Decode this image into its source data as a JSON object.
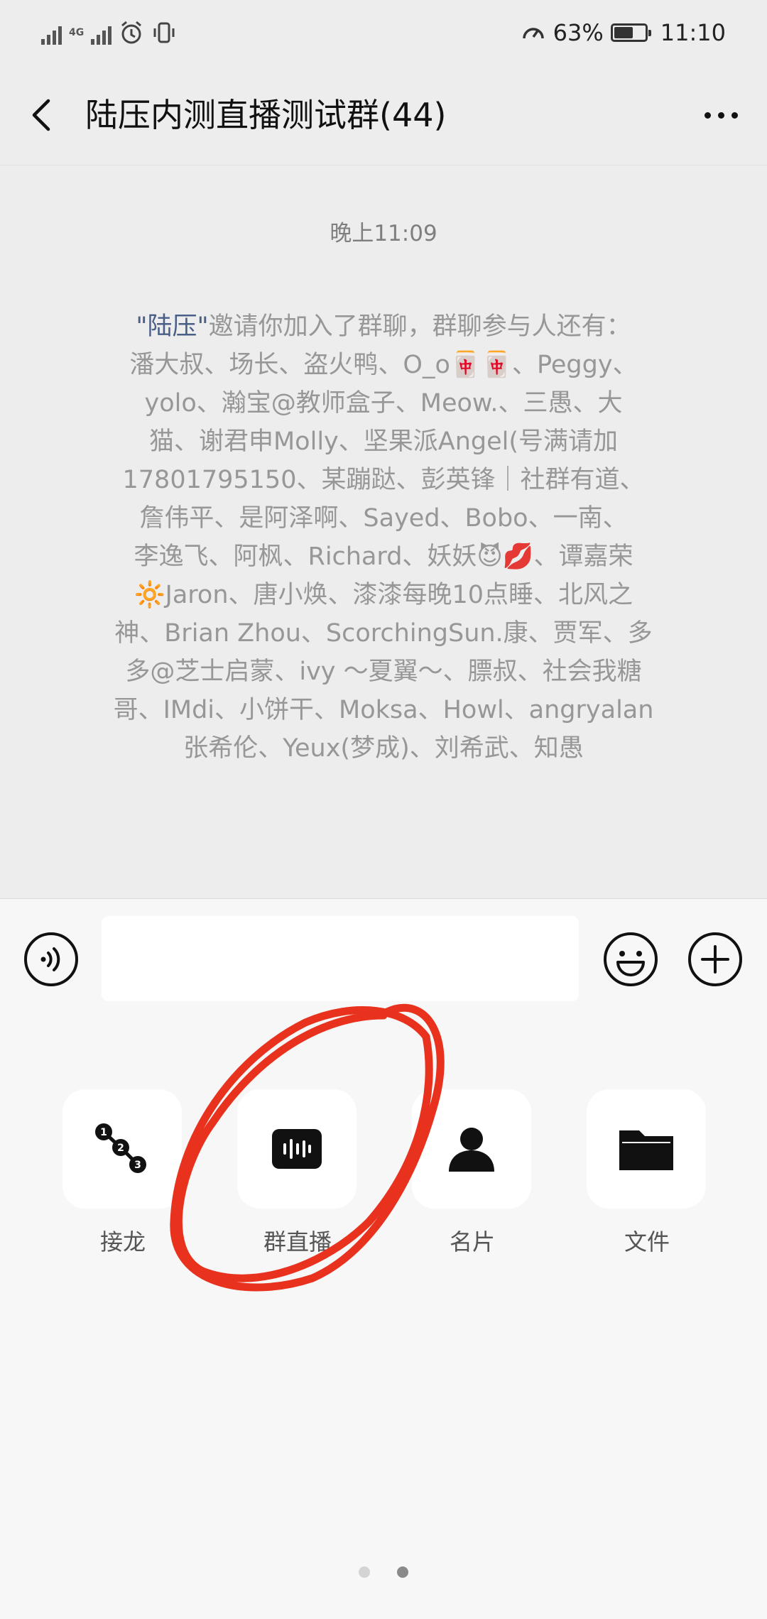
{
  "status_bar": {
    "network_type": "4G",
    "battery": "63%",
    "battery_level": 0.63,
    "time": "11:10"
  },
  "nav": {
    "title": "陆压内测直播测试群(44)"
  },
  "chat": {
    "timestamp": "晚上11:09",
    "system_message": {
      "inviter_quote_open": "\"",
      "inviter": "陆压",
      "inviter_quote_close": "\"",
      "text": "邀请你加入了群聊，群聊参与人还有：\n潘大叔、场长、盗火鸭、O_o🀄🀄、Peggy、\nyolo、瀚宝@教师盒子、Meow.、三愚、大\n猫、谢君申Molly、坚果派Angel(号满请加\n17801795150、某蹦跶、彭英锋｜社群有道、\n詹伟平、是阿泽啊、Sayed、Bobo、一南、\n李逸飞、阿枫、Richard、妖妖😈💋、谭嘉荣\n🔆Jaron⁩、唐小焕、漆漆每晚10点睡、北风之\n神、Brian Zhou、ScorchingSun.康、贾军、多\n多@芝士启蒙、ivy ～夏翼～、膘叔、社会我糖\n哥、IMdi、小饼干、Moksa、Howl、angryalan\n张希伦、Yeux(梦成)、刘希武⁩、知愚"
    }
  },
  "panel": {
    "items": [
      {
        "label": "接龙",
        "icon": "solitaire-icon"
      },
      {
        "label": "群直播",
        "icon": "group-live-icon"
      },
      {
        "label": "名片",
        "icon": "contact-card-icon"
      },
      {
        "label": "文件",
        "icon": "file-folder-icon"
      }
    ],
    "page_indicator": {
      "pages": 2,
      "current": 2
    }
  },
  "colors": {
    "inviter_link": "#4a5f87",
    "annotation_red": "#e8321e"
  }
}
